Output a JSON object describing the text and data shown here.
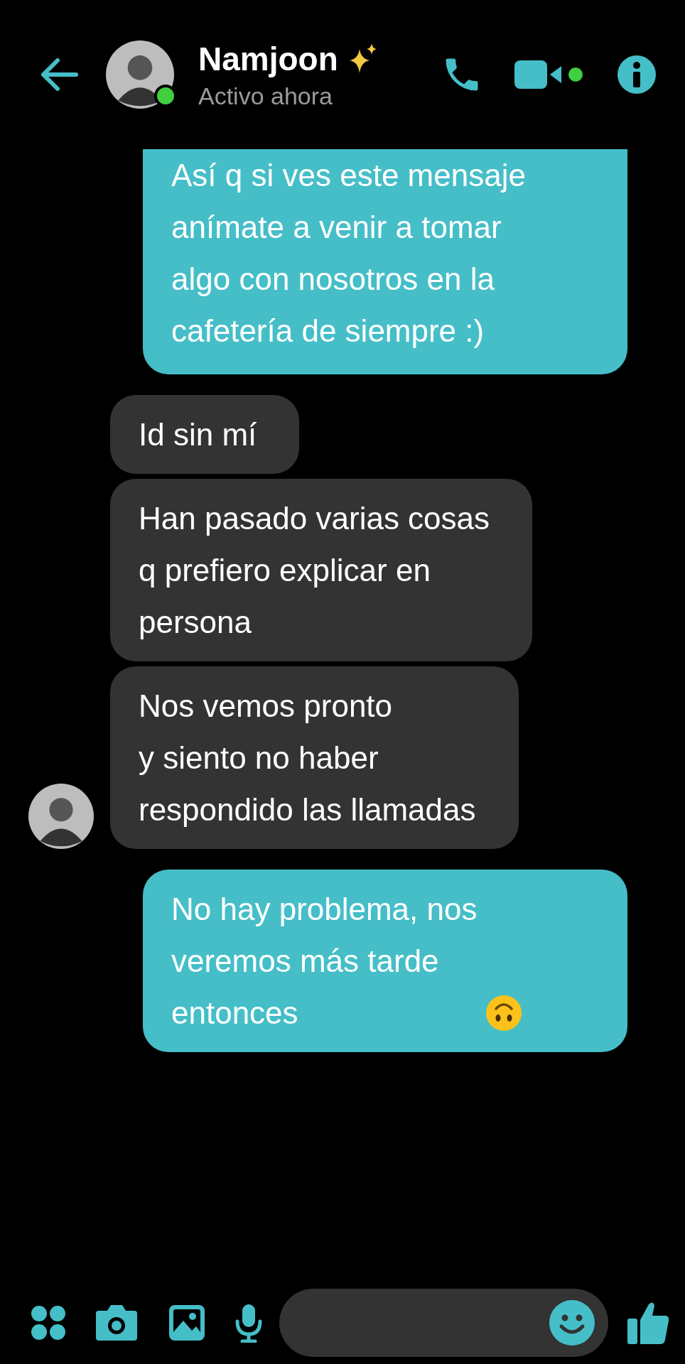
{
  "header": {
    "name": "Namjoon",
    "status": "Activo ahora",
    "online": true
  },
  "messages": [
    {
      "kind": "sent",
      "text": "Así q si ves este mensaje\nanímate a venir a tomar\nalgo con nosotros en la\ncafetería de siempre :)",
      "cut_top": true
    },
    {
      "kind": "received",
      "text": "Id sin mí",
      "show_avatar": false
    },
    {
      "kind": "received",
      "text": "Han pasado varias cosas\nq prefiero explicar en\npersona",
      "show_avatar": false
    },
    {
      "kind": "received",
      "text": "Nos vemos pronto\ny siento no haber\nrespondido las llamadas",
      "show_avatar": true
    },
    {
      "kind": "sent",
      "text": "No hay problema, nos\nveremos más tarde\nentonces",
      "emoji": true
    }
  ]
}
